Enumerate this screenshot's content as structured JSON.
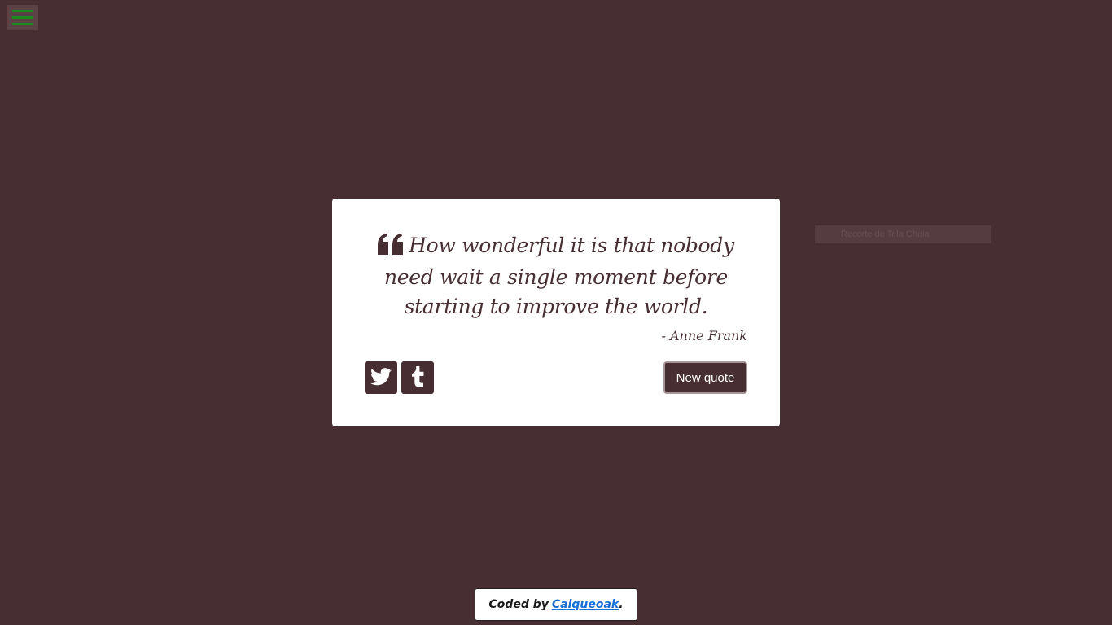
{
  "menu": {
    "icon": "hamburger-icon",
    "color": "#1a8a1a"
  },
  "overlay": {
    "label": "Recorte de Tela Cheia"
  },
  "quote": {
    "text": "How wonderful it is that nobody need wait a single moment before starting to improve the world.",
    "author": "- Anne Frank",
    "mark_icon": "quote-left-icon"
  },
  "actions": {
    "twitter_icon": "twitter-icon",
    "tumblr_icon": "tumblr-icon",
    "new_quote_label": "New quote"
  },
  "footer": {
    "prefix": "Coded by",
    "link_text": "Caiqueoak",
    "suffix": "."
  },
  "colors": {
    "background": "#472e32",
    "card": "#ffffff",
    "link": "#1a6fd6"
  }
}
